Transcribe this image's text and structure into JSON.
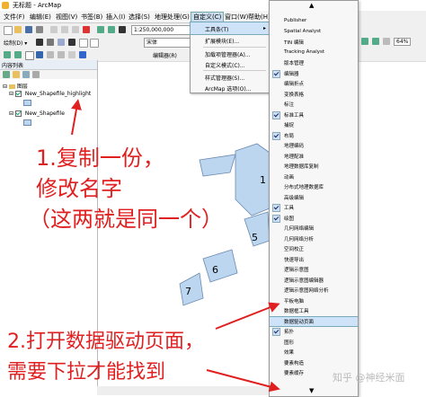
{
  "window": {
    "title": "无标题 - ArcMap"
  },
  "menubar": {
    "items": [
      "文件(F)",
      "编辑(E)",
      "视图(V)",
      "书签(B)",
      "插入(I)",
      "选择(S)",
      "地理处理(G)",
      "自定义(C)",
      "窗口(W)",
      "帮助(H)"
    ]
  },
  "toolbar": {
    "scale": "1:250,000,000",
    "font": "宋体",
    "edit_label": "编辑器(R)",
    "zoom": "64%"
  },
  "toc": {
    "title": "内容列表",
    "root": "图层",
    "layers": [
      {
        "name": "New_Shapefile_highlight",
        "checked": true
      },
      {
        "name": "New_Shapefile",
        "checked": true
      }
    ]
  },
  "customize_menu": {
    "items": [
      {
        "label": "工具条(T)",
        "submenu": true,
        "highlighted": true
      },
      {
        "label": "扩展模块(E)...",
        "submenu": false
      },
      {
        "label": "加载项管理器(A)...",
        "submenu": false
      },
      {
        "label": "自定义模式(C)...",
        "submenu": false
      },
      {
        "label": "样式管理器(S)...",
        "submenu": false
      },
      {
        "label": "ArcMap 选项(O)...",
        "submenu": false
      }
    ]
  },
  "toolbars_menu": {
    "scroll_up": "▲",
    "scroll_down": "▼",
    "items": [
      {
        "label": "Publisher",
        "checked": false
      },
      {
        "label": "Spatial Analyst",
        "checked": false
      },
      {
        "label": "TIN 编辑",
        "checked": false
      },
      {
        "label": "Tracking Analyst",
        "checked": false
      },
      {
        "label": "版本管理",
        "checked": false
      },
      {
        "label": "编辑器",
        "checked": true
      },
      {
        "label": "编辑折点",
        "checked": false
      },
      {
        "label": "变换表格",
        "checked": false
      },
      {
        "label": "标注",
        "checked": false
      },
      {
        "label": "标准工具",
        "checked": true
      },
      {
        "label": "捕捉",
        "checked": false
      },
      {
        "label": "布局",
        "checked": true
      },
      {
        "label": "地理编码",
        "checked": false
      },
      {
        "label": "地理配准",
        "checked": false
      },
      {
        "label": "地理数据库复制",
        "checked": false
      },
      {
        "label": "动画",
        "checked": false
      },
      {
        "label": "分布式地理数据库",
        "checked": false
      },
      {
        "label": "高级编辑",
        "checked": false
      },
      {
        "label": "工具",
        "checked": true
      },
      {
        "label": "绘图",
        "checked": true
      },
      {
        "label": "几何网络编辑",
        "checked": false
      },
      {
        "label": "几何网络分析",
        "checked": false
      },
      {
        "label": "空间校正",
        "checked": false
      },
      {
        "label": "快速导出",
        "checked": false
      },
      {
        "label": "逻辑示意图",
        "checked": false
      },
      {
        "label": "逻辑示意图编辑器",
        "checked": false
      },
      {
        "label": "逻辑示意图网络分析",
        "checked": false
      },
      {
        "label": "平板电脑",
        "checked": false
      },
      {
        "label": "数据框工具",
        "checked": false
      },
      {
        "label": "数据驱动页面",
        "checked": false,
        "highlighted": true
      },
      {
        "label": "拓扑",
        "checked": true
      },
      {
        "label": "图形",
        "checked": false
      },
      {
        "label": "效果",
        "checked": false
      },
      {
        "label": "要素构造",
        "checked": false
      },
      {
        "label": "要素缓存",
        "checked": false
      }
    ]
  },
  "map": {
    "labels": [
      "1",
      "5",
      "6",
      "7"
    ]
  },
  "annotations": {
    "note1": [
      "1.复制一份，",
      "修改名字",
      "（这两就是同一个）"
    ],
    "note2": [
      "2.打开数据驱动页面，",
      "需要下拉才能找到"
    ]
  },
  "watermark": "知乎 @神经米面",
  "colors": {
    "annotation": "#e02020",
    "polygon_fill": "#bcd6f0",
    "polygon_stroke": "#6a8ab0",
    "highlight": "#cfe3f8"
  }
}
